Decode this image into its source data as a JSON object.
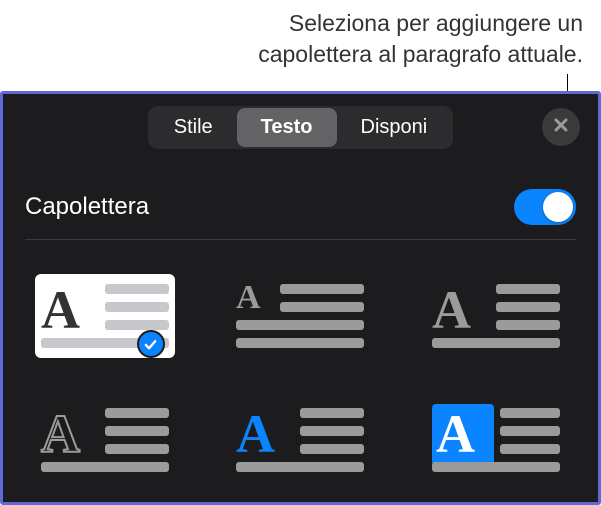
{
  "callout": {
    "line1": "Seleziona per aggiungere un",
    "line2": "capolettera al paragrafo attuale."
  },
  "tabs": {
    "style": "Stile",
    "text": "Testo",
    "arrange": "Disponi",
    "active_index": 1
  },
  "section": {
    "dropcap": {
      "label": "Capolettera",
      "enabled": true
    }
  },
  "options": {
    "selected_index": 0,
    "items": [
      {
        "name": "dropcap-raised-boxed",
        "boxed": true,
        "letter_color": "#9b9b9b",
        "small_letter": false,
        "highlight": false
      },
      {
        "name": "dropcap-raised-small",
        "boxed": false,
        "letter_color": "#9b9b9b",
        "small_letter": true,
        "highlight": false
      },
      {
        "name": "dropcap-raised-large",
        "boxed": false,
        "letter_color": "#9b9b9b",
        "small_letter": false,
        "highlight": false
      },
      {
        "name": "dropcap-outline",
        "boxed": false,
        "letter_color": "outline",
        "small_letter": false,
        "highlight": false
      },
      {
        "name": "dropcap-accent",
        "boxed": false,
        "letter_color": "#0a84ff",
        "small_letter": false,
        "highlight": false
      },
      {
        "name": "dropcap-highlight",
        "boxed": false,
        "letter_color": "#ffffff",
        "small_letter": false,
        "highlight": true
      }
    ]
  }
}
